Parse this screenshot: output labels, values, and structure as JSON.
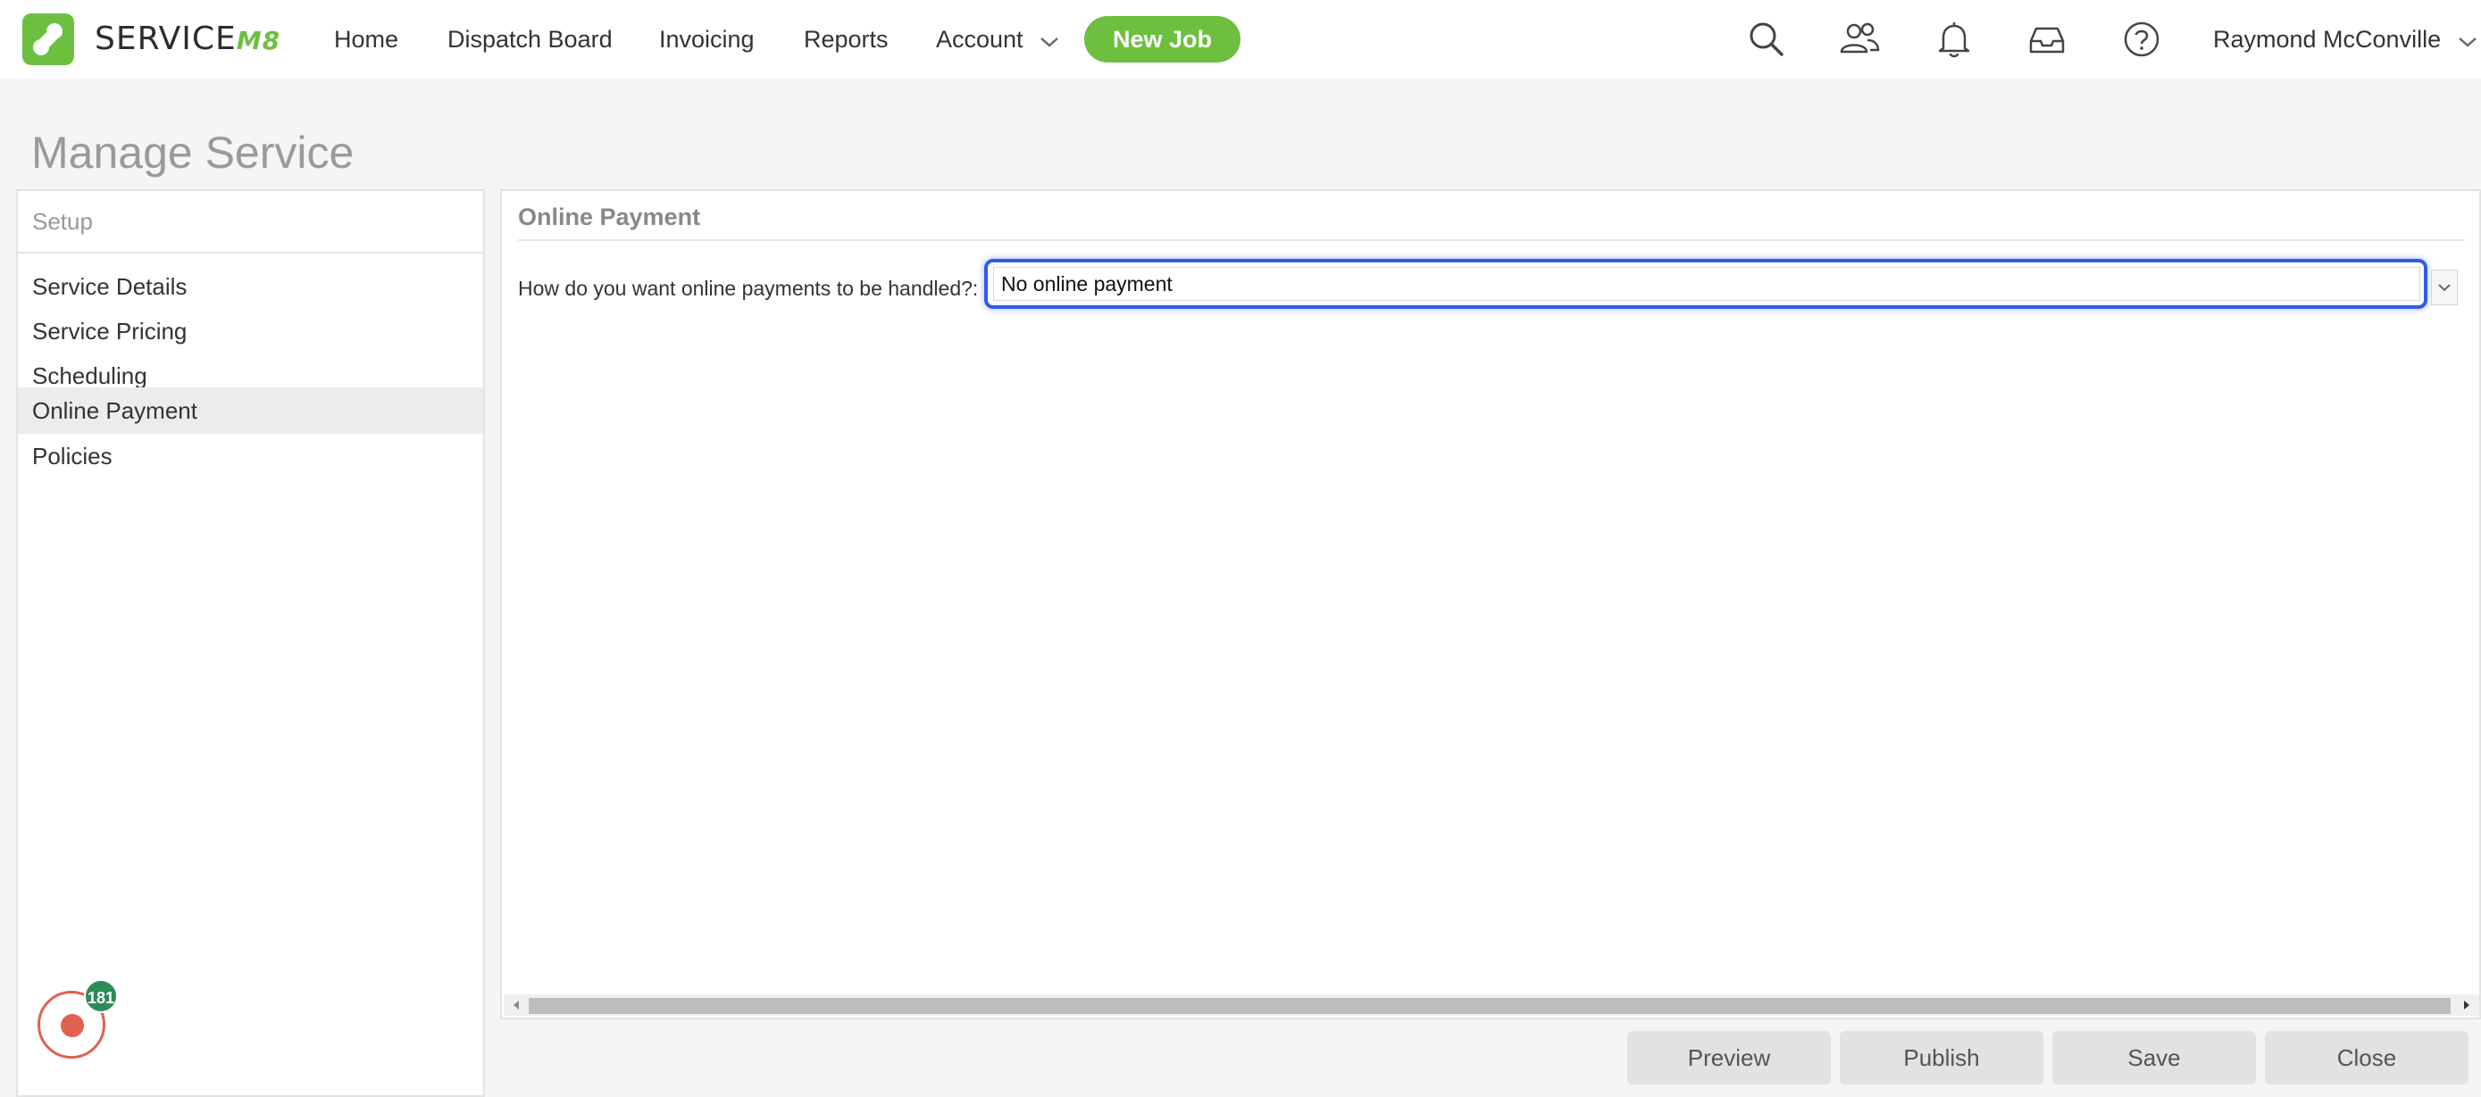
{
  "app": {
    "brand_text": "SERVICE",
    "brand_suffix": "M8",
    "accent_color": "#6cbf3f",
    "focus_color": "#2f5de8"
  },
  "nav": {
    "items": [
      {
        "label": "Home"
      },
      {
        "label": "Dispatch Board"
      },
      {
        "label": "Invoicing"
      },
      {
        "label": "Reports"
      },
      {
        "label": "Account"
      }
    ],
    "new_job_label": "New Job",
    "icons": [
      "search-icon",
      "people-icon",
      "bell-icon",
      "inbox-icon",
      "help-icon"
    ],
    "user_name": "Raymond McConville"
  },
  "page": {
    "title": "Manage Service"
  },
  "sidebar": {
    "header": "Setup",
    "items": [
      {
        "label": "Service Details",
        "active": false
      },
      {
        "label": "Service Pricing",
        "active": false
      },
      {
        "label": "Scheduling",
        "active": false
      },
      {
        "label": "Online Payment",
        "active": true
      },
      {
        "label": "Policies",
        "active": false
      }
    ],
    "record_badge_count": "181"
  },
  "main": {
    "section_title": "Online Payment",
    "field_label": "How do you want online payments to be handled?:",
    "select_value": "No online payment"
  },
  "footer": {
    "preview_label": "Preview",
    "publish_label": "Publish",
    "save_label": "Save",
    "close_label": "Close"
  }
}
